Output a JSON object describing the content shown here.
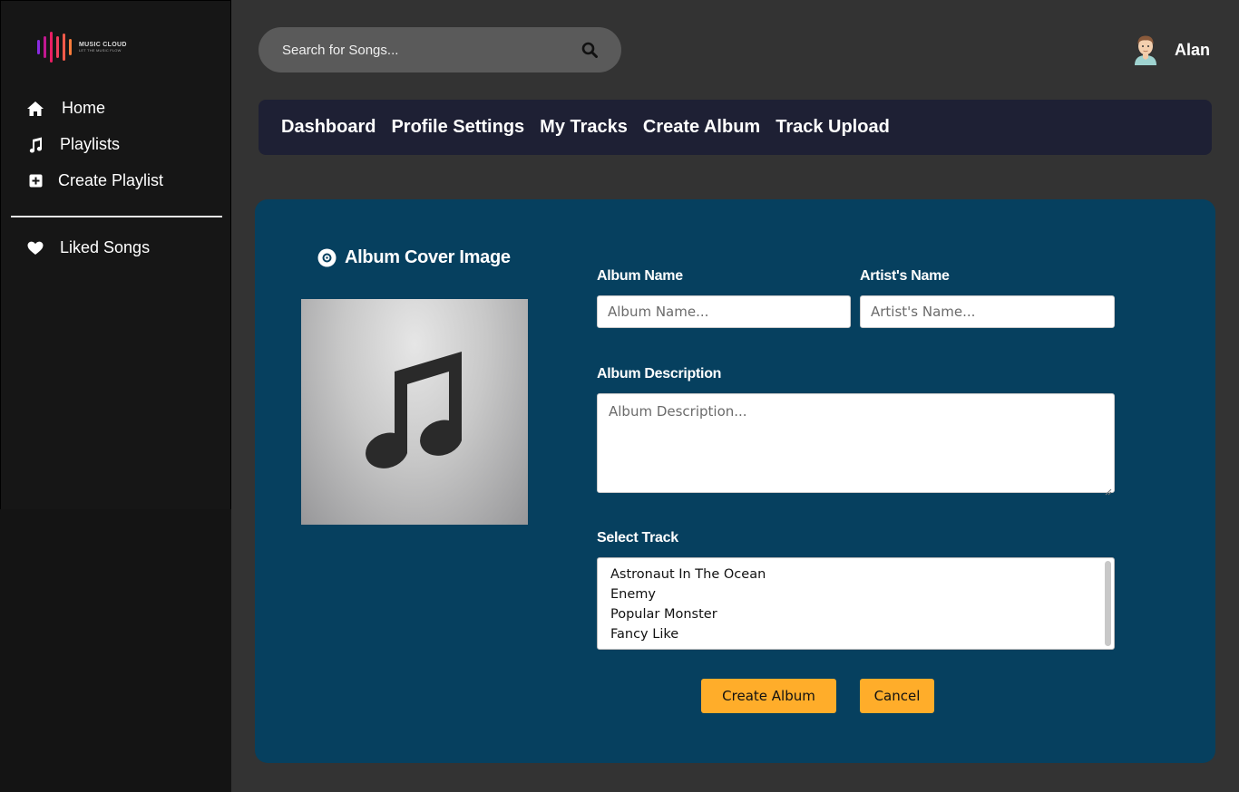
{
  "brand": {
    "name": "MUSIC CLOUD",
    "tagline": "LET THE MUSIC FLOW",
    "bar_colors": [
      "#7b2ff7",
      "#c2188f",
      "#e91e63",
      "#ef3d5c",
      "#f35a4a",
      "#f77b3a"
    ]
  },
  "sidebar": {
    "items": [
      {
        "label": "Home",
        "icon": "home-icon"
      },
      {
        "label": "Playlists",
        "icon": "music-note-icon"
      },
      {
        "label": "Create Playlist",
        "icon": "plus-square-icon"
      }
    ],
    "secondary": [
      {
        "label": "Liked Songs",
        "icon": "heart-icon"
      }
    ]
  },
  "search": {
    "placeholder": "Search for Songs..."
  },
  "user": {
    "name": "Alan"
  },
  "tabs": [
    "Dashboard",
    "Profile Settings",
    "My Tracks",
    "Create Album",
    "Track Upload"
  ],
  "form": {
    "cover_title": "Album Cover Image",
    "album_name_label": "Album Name",
    "album_name_placeholder": "Album Name...",
    "artist_name_label": "Artist's Name",
    "artist_name_placeholder": "Artist's Name...",
    "description_label": "Album Description",
    "description_placeholder": "Album Description...",
    "track_label": "Select Track",
    "tracks": [
      "Astronaut In The Ocean",
      "Enemy",
      "Popular Monster",
      "Fancy Like"
    ],
    "create_button": "Create Album",
    "cancel_button": "Cancel"
  },
  "colors": {
    "accent": "#ffad2a",
    "panel": "#06405f",
    "tabs_bar": "#1e2034",
    "background": "#333333"
  }
}
